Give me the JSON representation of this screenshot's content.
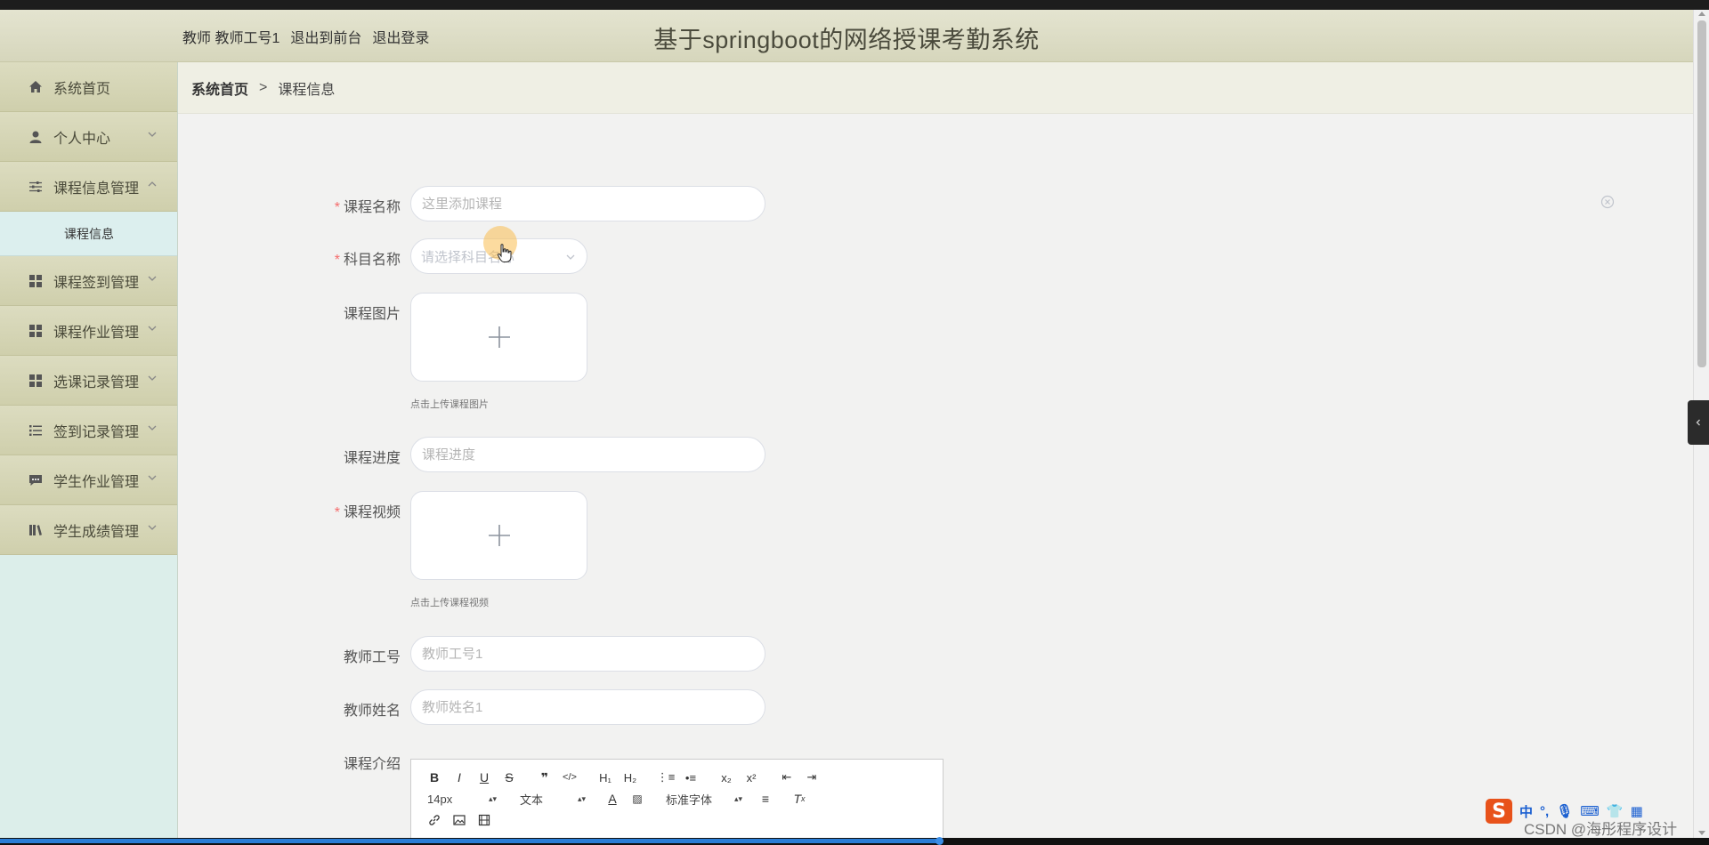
{
  "header": {
    "links": [
      "教师 教师工号1",
      "退出到前台",
      "退出登录"
    ],
    "title": "基于springboot的网络授课考勤系统"
  },
  "sidebar": {
    "items": [
      {
        "label": "系统首页",
        "icon": "home-icon",
        "expanded": false,
        "has_chevron": false
      },
      {
        "label": "个人中心",
        "icon": "user-icon",
        "expanded": false,
        "has_chevron": true
      },
      {
        "label": "课程信息管理",
        "icon": "sliders-icon",
        "expanded": true,
        "has_chevron": true,
        "children": [
          "课程信息"
        ]
      },
      {
        "label": "课程签到管理",
        "icon": "grid-icon",
        "expanded": false,
        "has_chevron": true
      },
      {
        "label": "课程作业管理",
        "icon": "grid-icon",
        "expanded": false,
        "has_chevron": true
      },
      {
        "label": "选课记录管理",
        "icon": "grid-icon",
        "expanded": false,
        "has_chevron": true
      },
      {
        "label": "签到记录管理",
        "icon": "list-icon",
        "expanded": false,
        "has_chevron": true
      },
      {
        "label": "学生作业管理",
        "icon": "chat-icon",
        "expanded": false,
        "has_chevron": true
      },
      {
        "label": "学生成绩管理",
        "icon": "book-icon",
        "expanded": false,
        "has_chevron": true
      }
    ]
  },
  "breadcrumb": {
    "home": "系统首页",
    "separator": ">",
    "current": "课程信息"
  },
  "form": {
    "course_name": {
      "label": "课程名称",
      "required": true,
      "placeholder": "这里添加课程",
      "value": ""
    },
    "subject_name": {
      "label": "科目名称",
      "required": true,
      "placeholder": "请选择科目名称",
      "value": ""
    },
    "course_image": {
      "label": "课程图片",
      "required": false,
      "hint": "点击上传课程图片"
    },
    "course_progress": {
      "label": "课程进度",
      "required": false,
      "placeholder": "课程进度",
      "value": ""
    },
    "course_video": {
      "label": "课程视频",
      "required": true,
      "hint": "点击上传课程视频"
    },
    "teacher_id": {
      "label": "教师工号",
      "required": false,
      "placeholder": "教师工号1",
      "value": ""
    },
    "teacher_name": {
      "label": "教师姓名",
      "required": false,
      "placeholder": "教师姓名1",
      "value": ""
    },
    "course_intro": {
      "label": "课程介绍",
      "required": false
    }
  },
  "editor": {
    "font_size": "14px",
    "text_style": "文本",
    "font_family": "标准字体"
  },
  "ime": {
    "logo": "S",
    "mode": "中"
  },
  "watermark": "CSDN @海彤程序设计",
  "colors": {
    "header_bg": "#dcdcc2",
    "sidebar_item_bg": "#d6d6b6",
    "submenu_bg": "#dcefee",
    "required_star": "#f56c6c",
    "page_bg": "#f2f2f1"
  }
}
